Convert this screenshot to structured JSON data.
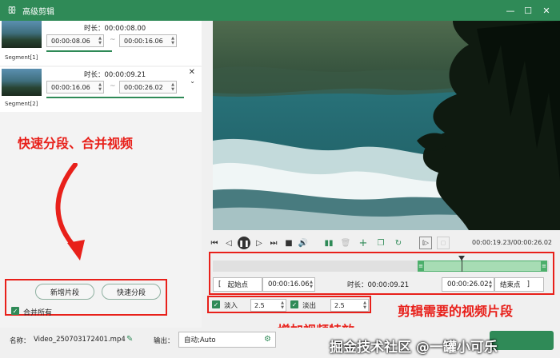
{
  "window": {
    "title": "高级剪辑"
  },
  "segments": [
    {
      "label": "Segment[1]",
      "duration_label": "时长：00:00:08.00",
      "start": "00:00:08.06",
      "end": "00:00:16.06"
    },
    {
      "label": "Segment[2]",
      "duration_label": "时长：00:00:09.21",
      "start": "00:00:16.06",
      "end": "00:00:26.02"
    }
  ],
  "annotations": {
    "left": "快速分段、合并视频",
    "right": "剪辑需要的视频片段",
    "effects": "增加视频特效"
  },
  "buttons": {
    "add_segment": "新增片段",
    "quick_split": "快速分段"
  },
  "merge_all": {
    "label": "合并所有",
    "checked": true
  },
  "playback": {
    "current": "00:00:19.23",
    "total": "00:00:26.02",
    "separator": "/"
  },
  "timeline": {
    "selection_start_fraction": 0.617,
    "selection_end_fraction": 1.0,
    "playhead_fraction": 0.743
  },
  "range": {
    "start_btn": "起始点",
    "start_time": "00:00:16.06",
    "duration_label": "时长：00:00:09.21",
    "end_time": "00:00:26.02",
    "end_btn": "结束点",
    "open_bracket": "[",
    "close_bracket": "]"
  },
  "effects": {
    "fade_in_label": "淡入",
    "fade_in_value": "2.5",
    "fade_out_label": "淡出",
    "fade_out_value": "2.5"
  },
  "bottom": {
    "name_label": "名称：",
    "name_value": "Video_250703172401.mp4",
    "output_label": "输出：",
    "output_value": "自动;Auto"
  },
  "watermark": "掘金技术社区 @一罐小可乐",
  "colors": {
    "accent": "#2f8a57",
    "annotation_red": "#e8201a"
  }
}
